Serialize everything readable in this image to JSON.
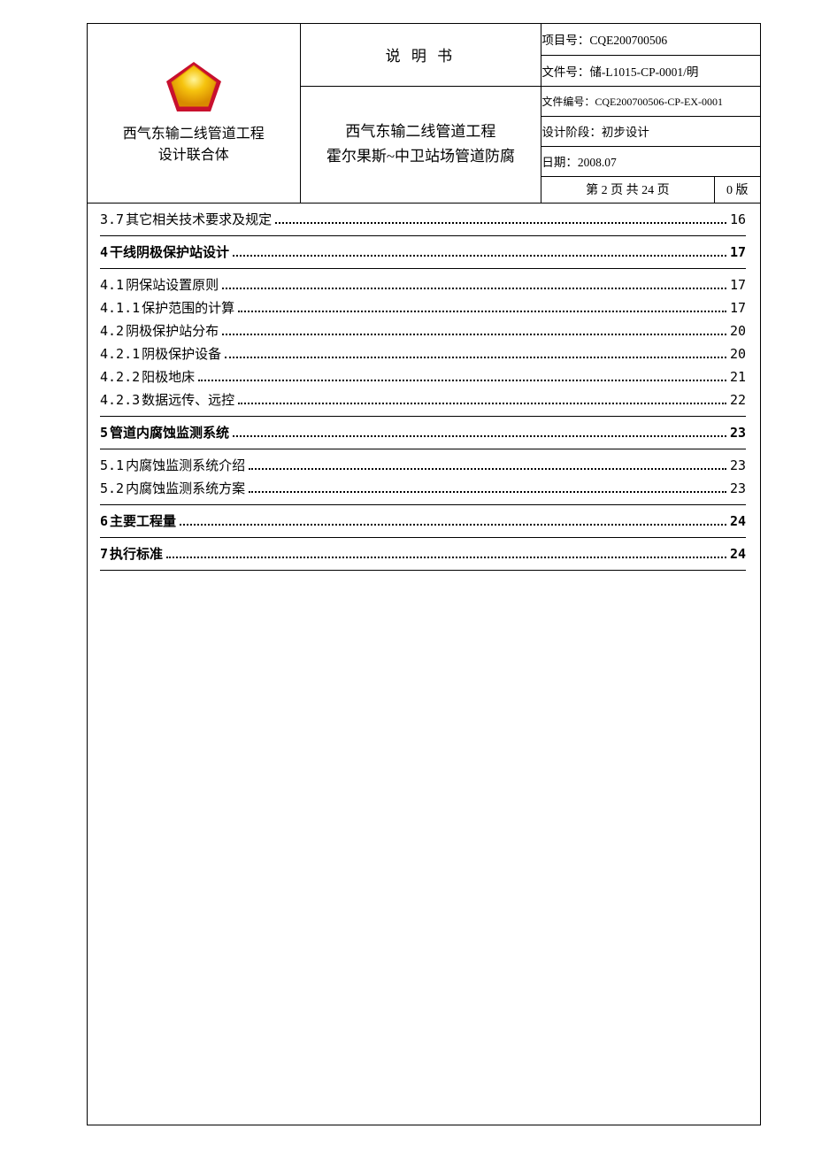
{
  "header": {
    "org_line1": "西气东输二线管道工程",
    "org_line2": "设计联合体",
    "doc_type": "说  明  书",
    "title_line1": "西气东输二线管道工程",
    "title_line2": "霍尔果斯~中卫站场管道防腐",
    "meta": {
      "project_no_label": "项目号：",
      "project_no": "CQE200700506",
      "file_no_label": "文件号：",
      "file_no": "储-L1015-CP-0001/明",
      "file_code_label": "文件编号：",
      "file_code": "CQE200700506-CP-EX-0001",
      "phase_label": "设计阶段：",
      "phase": "初步设计",
      "date_label": "日期：",
      "date": "2008.07",
      "pager": "第 2 页  共 24 页",
      "version": "0 版"
    }
  },
  "toc": [
    {
      "num": "3.7",
      "title": "其它相关技术要求及规定",
      "page": "16",
      "bold": false,
      "sep_after": true
    },
    {
      "num": "4",
      "title": "干线阴极保护站设计",
      "page": "17",
      "bold": true,
      "sep_after": true
    },
    {
      "num": "4.1",
      "title": "阴保站设置原则",
      "page": "17",
      "bold": false,
      "sep_after": false
    },
    {
      "num": "4.1.1",
      "title": "保护范围的计算",
      "page": "17",
      "bold": false,
      "sep_after": false
    },
    {
      "num": "4.2",
      "title": "阴极保护站分布",
      "page": "20",
      "bold": false,
      "sep_after": false
    },
    {
      "num": "4.2.1",
      "title": "阴极保护设备",
      "page": "20",
      "bold": false,
      "sep_after": false
    },
    {
      "num": "4.2.2",
      "title": "阳极地床",
      "page": "21",
      "bold": false,
      "sep_after": false
    },
    {
      "num": "4.2.3",
      "title": "数据远传、远控",
      "page": "22",
      "bold": false,
      "sep_after": true
    },
    {
      "num": "5",
      "title": "管道内腐蚀监测系统",
      "page": "23",
      "bold": true,
      "sep_after": true
    },
    {
      "num": "5.1",
      "title": "内腐蚀监测系统介绍",
      "page": "23",
      "bold": false,
      "sep_after": false
    },
    {
      "num": "5.2",
      "title": "内腐蚀监测系统方案",
      "page": "23",
      "bold": false,
      "sep_after": true
    },
    {
      "num": "6",
      "title": "主要工程量",
      "page": "24",
      "bold": true,
      "sep_after": true
    },
    {
      "num": "7",
      "title": "执行标准",
      "page": "24",
      "bold": true,
      "sep_after": true
    }
  ]
}
